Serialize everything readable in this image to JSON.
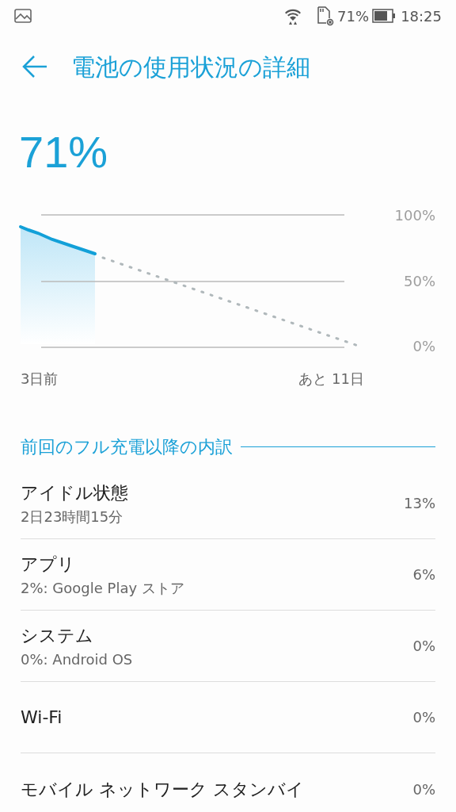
{
  "status_bar": {
    "battery": "71%",
    "time": "18:25"
  },
  "header": {
    "title": "電池の使用状況の詳細"
  },
  "battery_level": "71%",
  "chart": {
    "y_labels": [
      "100%",
      "50%",
      "0%"
    ],
    "x_start": "3日前",
    "x_end": "あと 11日"
  },
  "section": {
    "title": "前回のフル充電以降の内訳"
  },
  "items": [
    {
      "title": "アイドル状態",
      "subtitle": "2日23時間15分",
      "value": "13%"
    },
    {
      "title": "アプリ",
      "subtitle": "2%: Google Play ストア",
      "value": "6%"
    },
    {
      "title": "システム",
      "subtitle": "0%: Android OS",
      "value": "0%"
    },
    {
      "title": "Wi-Fi",
      "value": "0%"
    },
    {
      "title": "モバイル ネットワーク スタンバイ",
      "value": "0%"
    }
  ]
}
